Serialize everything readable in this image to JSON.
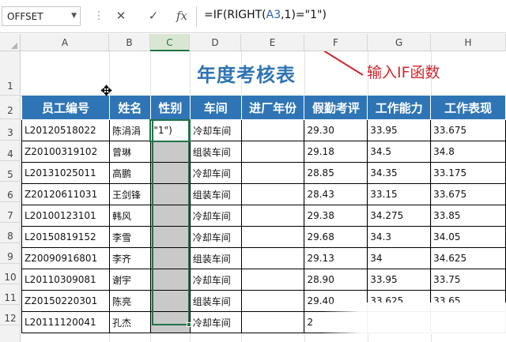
{
  "formula_bar": {
    "name_box": "OFFSET",
    "cancel_icon": "✕",
    "confirm_icon": "✓",
    "fx_label": "fx",
    "formula_prefix": "=IF(RIGHT(",
    "formula_ref": "A3",
    "formula_suffix": ",1)=\"1\")"
  },
  "columns": [
    "A",
    "B",
    "C",
    "D",
    "E",
    "F",
    "G",
    "H"
  ],
  "rows": [
    "1",
    "2",
    "3",
    "4",
    "5",
    "6",
    "7",
    "8",
    "9",
    "10",
    "11",
    "12"
  ],
  "selected_column": "C",
  "sheet": {
    "title": "年度考核表",
    "annotation": "输入IF函数",
    "annotation_color": "#d0262c",
    "title_color": "#2e74b5",
    "header_fill": "#2f75b5"
  },
  "table": {
    "headers": [
      "员工编号",
      "姓名",
      "性别",
      "车间",
      "进厂年份",
      "假勤考评",
      "工作能力",
      "工作表现"
    ],
    "rows": [
      [
        "L20120518022",
        "陈涓涓",
        "\"1\")",
        "冷却车间",
        "",
        "29.30",
        "33.95",
        "33.675"
      ],
      [
        "Z20100319102",
        "曾琳",
        "",
        "组装车间",
        "",
        "29.18",
        "34.5",
        "34.8"
      ],
      [
        "L20131025011",
        "高鹏",
        "",
        "冷却车间",
        "",
        "28.85",
        "34.35",
        "33.175"
      ],
      [
        "Z20120611031",
        "王剑锋",
        "",
        "组装车间",
        "",
        "28.43",
        "33.15",
        "33.675"
      ],
      [
        "L20100123101",
        "韩风",
        "",
        "冷却车间",
        "",
        "29.38",
        "34.275",
        "33.85"
      ],
      [
        "L20150819152",
        "李雪",
        "",
        "冷却车间",
        "",
        "29.68",
        "34.3",
        "34.05"
      ],
      [
        "Z20090916801",
        "李齐",
        "",
        "组装车间",
        "",
        "29.13",
        "34",
        "34.625"
      ],
      [
        "L20110309081",
        "谢宇",
        "",
        "冷却车间",
        "",
        "28.90",
        "33.95",
        "33.75"
      ],
      [
        "Z20150220301",
        "陈亮",
        "",
        "组装车间",
        "",
        "29.40",
        "33.625",
        "33.65"
      ],
      [
        "L20111120041",
        "孔杰",
        "",
        "冷却车间",
        "",
        "2",
        "",
        ""
      ]
    ]
  }
}
